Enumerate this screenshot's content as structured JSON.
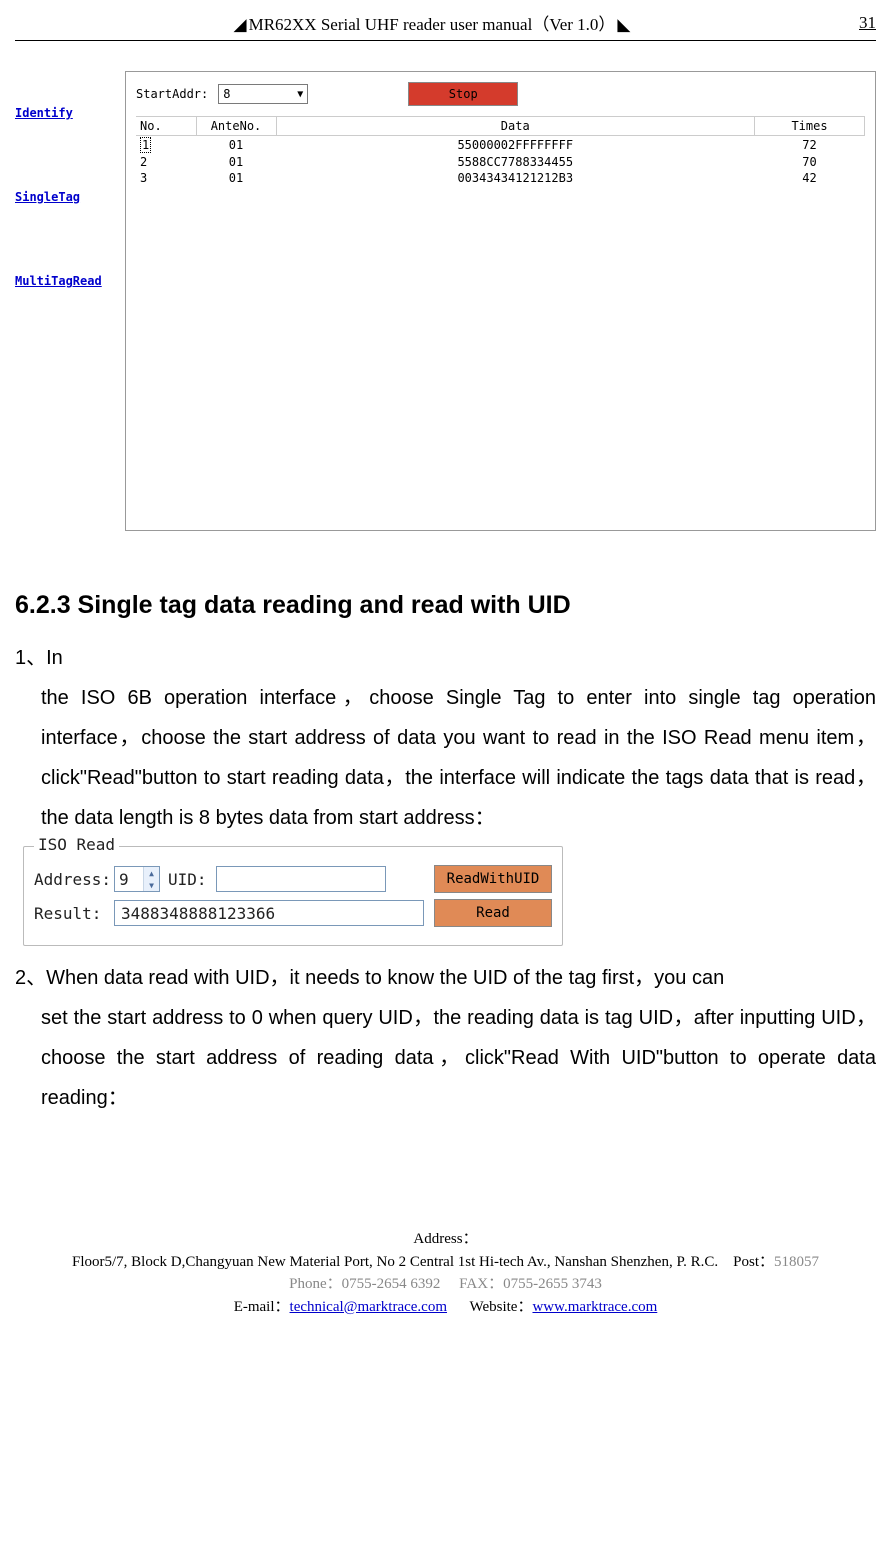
{
  "header": {
    "title": "MR62XX Serial UHF reader user manual（Ver 1.0）",
    "page_number": "31"
  },
  "screenshot1": {
    "sidebar": {
      "identify": "Identify",
      "singletag": "SingleTag",
      "multitag": "MultiTagRead"
    },
    "topbar": {
      "startaddr_label": "StartAddr:",
      "startaddr_value": "8",
      "stop_label": "Stop"
    },
    "table": {
      "headers": {
        "no": "No.",
        "ante": "AnteNo.",
        "data": "Data",
        "times": "Times"
      },
      "rows": [
        {
          "no": "1",
          "ante": "01",
          "data": "55000002FFFFFFFF",
          "times": "72"
        },
        {
          "no": "2",
          "ante": "01",
          "data": "5588CC7788334455",
          "times": "70"
        },
        {
          "no": "3",
          "ante": "01",
          "data": "00343434121212B3",
          "times": "42"
        }
      ]
    }
  },
  "section": {
    "heading": "6.2.3 Single tag data reading and read with UID",
    "para1_lead": "1、In ",
    "para1_rest": " the ISO 6B operation interface，choose Single Tag to enter into single tag operation interface，choose the start address of data you want to read in the ISO Read menu item，click\"Read\"button to start reading data，the interface will indicate the tags data that is read，the data length is 8 bytes data from start address：",
    "para2_lead": "2、When data read with UID，it needs to know the UID of the tag first，you can ",
    "para2_rest": "set the start address to 0 when query UID，the reading data is tag UID，after inputting UID，choose the start address of reading data，click\"Read With UID\"button to operate data reading："
  },
  "iso_box": {
    "title": "ISO Read",
    "address_label": "Address:",
    "address_value": "9",
    "uid_label": "UID:",
    "uid_value": "",
    "readwithuid_btn": "ReadWithUID",
    "result_label": "Result:",
    "result_value": "3488348888123366",
    "read_btn": "Read"
  },
  "footer": {
    "address_label": "Address：",
    "address_line1": "Floor5/7, Block D,Changyuan New  Material Port, No 2 Central 1st Hi-tech Av., Nanshan Shenzhen, P. R.C.",
    "post_label": "Post：",
    "post_value": "518057",
    "phone_label": "Phone：",
    "phone_value": "0755-2654 6392",
    "fax_label": "FAX：",
    "fax_value": "0755-2655 3743",
    "email_label": "E-mail：",
    "email_value": "technical@marktrace.com",
    "website_label": "Website：",
    "website_value": "www.marktrace.com"
  }
}
